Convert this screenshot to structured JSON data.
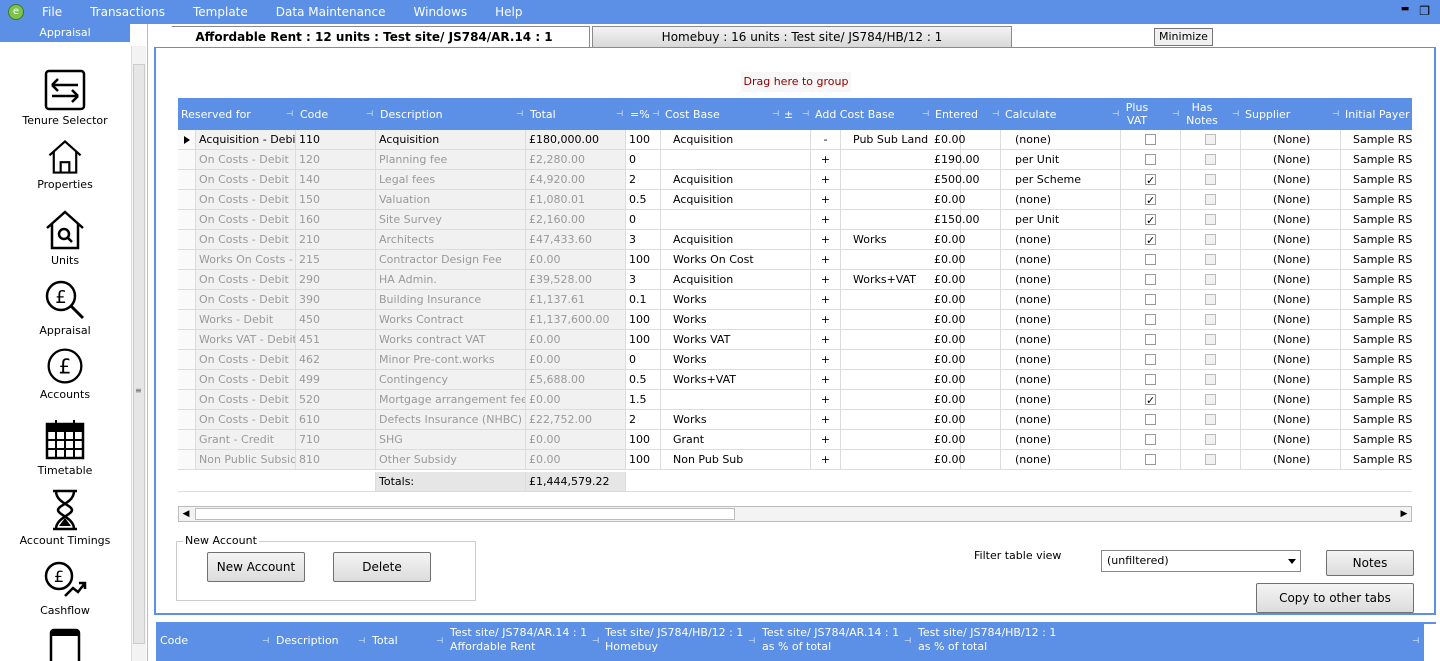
{
  "menu": {
    "items": [
      "File",
      "Transactions",
      "Template",
      "Data Maintenance",
      "Windows",
      "Help"
    ],
    "logo": "e"
  },
  "window_buttons": {
    "minimize": "▬",
    "restore": "❐"
  },
  "sidebar": {
    "header": "Appraisal",
    "items": [
      {
        "label": "Tenure Selector",
        "icon": "arrows-swap-icon"
      },
      {
        "label": "Properties",
        "icon": "house-icon"
      },
      {
        "label": "Units",
        "icon": "house-search-icon"
      },
      {
        "label": "Appraisal",
        "icon": "pound-magnifier-icon"
      },
      {
        "label": "Accounts",
        "icon": "pound-coin-icon"
      },
      {
        "label": "Timetable",
        "icon": "calendar-icon"
      },
      {
        "label": "Account Timings",
        "icon": "hourglass-icon"
      },
      {
        "label": "Cashflow",
        "icon": "pound-growth-icon"
      }
    ]
  },
  "tabs": [
    {
      "label": "Affordable Rent : 12 units : Test site/ JS784/AR.14 : 1",
      "active": true
    },
    {
      "label": "Homebuy : 16 units : Test site/ JS784/HB/12 : 1",
      "active": false
    }
  ],
  "tooltip": "Minimize",
  "group_area": "Drag here to group",
  "grid": {
    "columns": [
      "Reserved for",
      "Code",
      "Description",
      "Total",
      "=%",
      "Cost Base",
      "±",
      "Add Cost Base",
      "Entered",
      "Calculate",
      "Plus VAT",
      "Has Notes",
      "Supplier",
      "Initial Payer"
    ],
    "rows": [
      {
        "reserved": "Acquisition - Debit",
        "code": "110",
        "desc": "Acquisition",
        "total": "£180,000.00",
        "pct": "100",
        "base": "Acquisition",
        "pm": "-",
        "addbase": "Pub Sub Land",
        "entered": "£0.00",
        "calc": "(none)",
        "vat": false,
        "notes": false,
        "supplier": "(None)",
        "payer": "Sample RS",
        "current": true
      },
      {
        "reserved": "On Costs - Debit",
        "code": "120",
        "desc": "Planning fee",
        "total": "£2,280.00",
        "pct": "0",
        "base": "",
        "pm": "+",
        "addbase": "",
        "entered": "£190.00",
        "calc": "per Unit",
        "vat": false,
        "notes": false,
        "supplier": "(None)",
        "payer": "Sample RS"
      },
      {
        "reserved": "On Costs - Debit",
        "code": "140",
        "desc": "Legal fees",
        "total": "£4,920.00",
        "pct": "2",
        "base": "Acquisition",
        "pm": "+",
        "addbase": "",
        "entered": "£500.00",
        "calc": "per Scheme",
        "vat": true,
        "notes": false,
        "supplier": "(None)",
        "payer": "Sample RS"
      },
      {
        "reserved": "On Costs - Debit",
        "code": "150",
        "desc": "Valuation",
        "total": "£1,080.01",
        "pct": "0.5",
        "base": "Acquisition",
        "pm": "+",
        "addbase": "",
        "entered": "£0.00",
        "calc": "(none)",
        "vat": true,
        "notes": false,
        "supplier": "(None)",
        "payer": "Sample RS"
      },
      {
        "reserved": "On Costs - Debit",
        "code": "160",
        "desc": "Site Survey",
        "total": "£2,160.00",
        "pct": "0",
        "base": "",
        "pm": "+",
        "addbase": "",
        "entered": "£150.00",
        "calc": "per Unit",
        "vat": true,
        "notes": false,
        "supplier": "(None)",
        "payer": "Sample RS"
      },
      {
        "reserved": "On Costs - Debit",
        "code": "210",
        "desc": "Architects",
        "total": "£47,433.60",
        "pct": "3",
        "base": "Acquisition",
        "pm": "+",
        "addbase": "Works",
        "entered": "£0.00",
        "calc": "(none)",
        "vat": true,
        "notes": false,
        "supplier": "(None)",
        "payer": "Sample RS"
      },
      {
        "reserved": "Works On Costs -",
        "code": "215",
        "desc": "Contractor Design Fee",
        "total": "£0.00",
        "pct": "100",
        "base": "Works On Cost",
        "pm": "+",
        "addbase": "",
        "entered": "£0.00",
        "calc": "(none)",
        "vat": false,
        "notes": false,
        "supplier": "(None)",
        "payer": "Sample RS"
      },
      {
        "reserved": "On Costs - Debit",
        "code": "290",
        "desc": "HA Admin.",
        "total": "£39,528.00",
        "pct": "3",
        "base": "Acquisition",
        "pm": "+",
        "addbase": "Works+VAT",
        "entered": "£0.00",
        "calc": "(none)",
        "vat": false,
        "notes": false,
        "supplier": "(None)",
        "payer": "Sample RS"
      },
      {
        "reserved": "On Costs - Debit",
        "code": "390",
        "desc": "Building Insurance",
        "total": "£1,137.61",
        "pct": "0.1",
        "base": "Works",
        "pm": "+",
        "addbase": "",
        "entered": "£0.00",
        "calc": "(none)",
        "vat": false,
        "notes": false,
        "supplier": "(None)",
        "payer": "Sample RS"
      },
      {
        "reserved": "Works - Debit",
        "code": "450",
        "desc": "Works Contract",
        "total": "£1,137,600.00",
        "pct": "100",
        "base": "Works",
        "pm": "+",
        "addbase": "",
        "entered": "£0.00",
        "calc": "(none)",
        "vat": false,
        "notes": false,
        "supplier": "(None)",
        "payer": "Sample RS"
      },
      {
        "reserved": "Works VAT - Debit",
        "code": "451",
        "desc": "Works contract VAT",
        "total": "£0.00",
        "pct": "100",
        "base": "Works VAT",
        "pm": "+",
        "addbase": "",
        "entered": "£0.00",
        "calc": "(none)",
        "vat": false,
        "notes": false,
        "supplier": "(None)",
        "payer": "Sample RS"
      },
      {
        "reserved": "On Costs - Debit",
        "code": "462",
        "desc": "Minor Pre-cont.works",
        "total": "£0.00",
        "pct": "0",
        "base": "Works",
        "pm": "+",
        "addbase": "",
        "entered": "£0.00",
        "calc": "(none)",
        "vat": false,
        "notes": false,
        "supplier": "(None)",
        "payer": "Sample RS"
      },
      {
        "reserved": "On Costs - Debit",
        "code": "499",
        "desc": "Contingency",
        "total": "£5,688.00",
        "pct": "0.5",
        "base": "Works+VAT",
        "pm": "+",
        "addbase": "",
        "entered": "£0.00",
        "calc": "(none)",
        "vat": false,
        "notes": false,
        "supplier": "(None)",
        "payer": "Sample RS"
      },
      {
        "reserved": "On Costs - Debit",
        "code": "520",
        "desc": "Mortgage arrangement fee",
        "total": "£0.00",
        "pct": "1.5",
        "base": "",
        "pm": "+",
        "addbase": "",
        "entered": "£0.00",
        "calc": "(none)",
        "vat": true,
        "notes": false,
        "supplier": "(None)",
        "payer": "Sample RS"
      },
      {
        "reserved": "On Costs - Debit",
        "code": "610",
        "desc": "Defects Insurance (NHBC)",
        "total": "£22,752.00",
        "pct": "2",
        "base": "Works",
        "pm": "+",
        "addbase": "",
        "entered": "£0.00",
        "calc": "(none)",
        "vat": false,
        "notes": false,
        "supplier": "(None)",
        "payer": "Sample RS"
      },
      {
        "reserved": "Grant - Credit",
        "code": "710",
        "desc": "SHG",
        "total": "£0.00",
        "pct": "100",
        "base": "Grant",
        "pm": "+",
        "addbase": "",
        "entered": "£0.00",
        "calc": "(none)",
        "vat": false,
        "notes": false,
        "supplier": "(None)",
        "payer": "Sample RS"
      },
      {
        "reserved": "Non Public Subsid",
        "code": "810",
        "desc": "Other Subsidy",
        "total": "£0.00",
        "pct": "100",
        "base": "Non Pub Sub",
        "pm": "+",
        "addbase": "",
        "entered": "£0.00",
        "calc": "(none)",
        "vat": false,
        "notes": false,
        "supplier": "(None)",
        "payer": "Sample RS"
      }
    ],
    "totals_label": "Totals:",
    "totals_value": "£1,444,579.22"
  },
  "new_account": {
    "legend": "New Account",
    "new_button": "New Account",
    "delete_button": "Delete"
  },
  "filter": {
    "label": "Filter table view",
    "value": "(unfiltered)"
  },
  "notes_button": "Notes",
  "copy_button": "Copy to other tabs",
  "bottom_grid": {
    "columns": [
      "Code",
      "Description",
      "Total",
      "Test site/ JS784/AR.14 : 1 Affordable Rent",
      "Test site/ JS784/HB/12 : 1 Homebuy",
      "Test site/ JS784/AR.14 : 1 as % of total",
      "Test site/ JS784/HB/12 : 1 as % of total"
    ]
  }
}
